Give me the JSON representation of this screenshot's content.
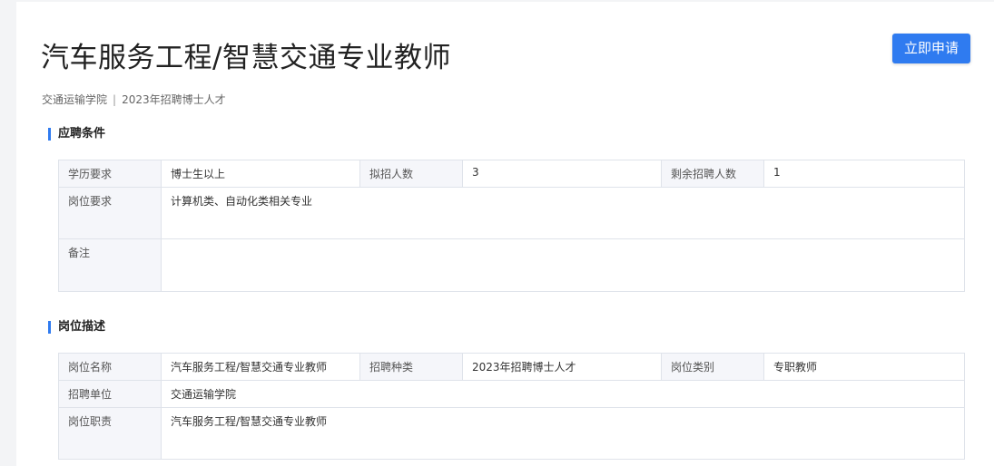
{
  "job": {
    "title": "汽车服务工程/智慧交通专业教师",
    "apply_label": "立即申请",
    "college": "交通运输学院",
    "separator": "|",
    "program": "2023年招聘博士人才"
  },
  "conditions": {
    "section_title": "应聘条件",
    "education_label": "学历要求",
    "education_value": "博士生以上",
    "planned_label": "拟招人数",
    "planned_value": "3",
    "remaining_label": "剩余招聘人数",
    "remaining_value": "1",
    "requirement_label": "岗位要求",
    "requirement_value": "计算机类、自动化类相关专业",
    "remark_label": "备注",
    "remark_value": ""
  },
  "description": {
    "section_title": "岗位描述",
    "name_label": "岗位名称",
    "name_value": "汽车服务工程/智慧交通专业教师",
    "type_label": "招聘种类",
    "type_value": "2023年招聘博士人才",
    "category_label": "岗位类别",
    "category_value": "专职教师",
    "unit_label": "招聘单位",
    "unit_value": "交通运输学院",
    "duty_label": "岗位职责",
    "duty_value": "汽车服务工程/智慧交通专业教师"
  },
  "colors": {
    "accent": "#2f7bf0",
    "label_bg": "#f5f6fa",
    "border": "#dfe3ea"
  }
}
